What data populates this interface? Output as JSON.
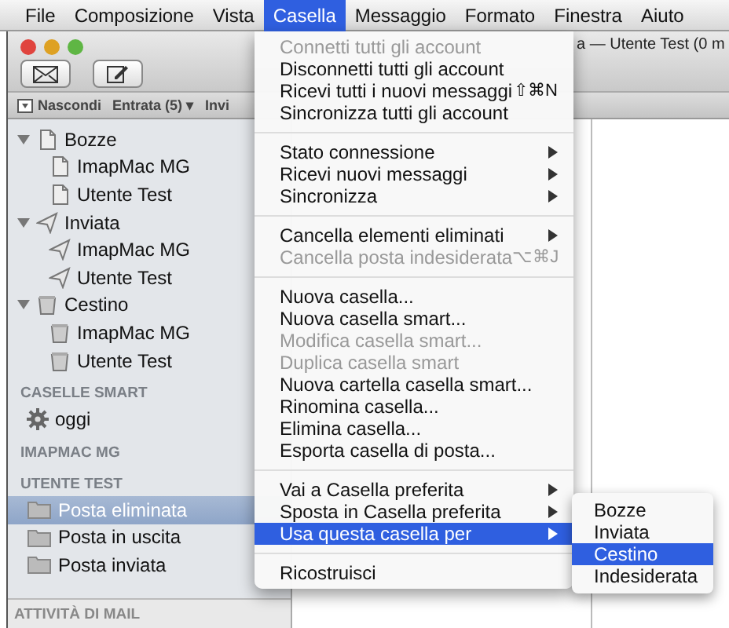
{
  "menubar": {
    "items": [
      {
        "label": "File",
        "selected": false
      },
      {
        "label": "Composizione",
        "selected": false
      },
      {
        "label": "Vista",
        "selected": false
      },
      {
        "label": "Casella",
        "selected": true
      },
      {
        "label": "Messaggio",
        "selected": false
      },
      {
        "label": "Formato",
        "selected": false
      },
      {
        "label": "Finestra",
        "selected": false
      },
      {
        "label": "Aiuto",
        "selected": false
      }
    ]
  },
  "window": {
    "title": "a — Utente Test (0 m",
    "favorites_bar": [
      {
        "label": "Nascondi",
        "kind": "hide"
      },
      {
        "label": "Entrata (5) ▾",
        "kind": "mailbox"
      },
      {
        "label": "Invi",
        "kind": "mailbox"
      }
    ]
  },
  "sidebar": {
    "tree": [
      {
        "label": "Bozze",
        "kind": "draft",
        "expanded": true,
        "children": [
          {
            "label": "ImapMac MG",
            "kind": "draft"
          },
          {
            "label": "Utente Test",
            "kind": "draft"
          }
        ]
      },
      {
        "label": "Inviata",
        "kind": "sent",
        "expanded": true,
        "children": [
          {
            "label": "ImapMac MG",
            "kind": "sent"
          },
          {
            "label": "Utente Test",
            "kind": "sent"
          }
        ]
      },
      {
        "label": "Cestino",
        "kind": "trash",
        "expanded": true,
        "children": [
          {
            "label": "ImapMac MG",
            "kind": "trash"
          },
          {
            "label": "Utente Test",
            "kind": "trash"
          }
        ]
      }
    ],
    "sections": [
      {
        "title": "CASELLE SMART",
        "items": [
          {
            "label": "oggi",
            "kind": "smart",
            "selected": false
          }
        ]
      },
      {
        "title": "IMAPMAC MG"
      },
      {
        "title": "UTENTE TEST",
        "items": [
          {
            "label": "Posta eliminata",
            "kind": "folder",
            "selected": true
          },
          {
            "label": "Posta in uscita",
            "kind": "folder",
            "selected": false
          },
          {
            "label": "Posta inviata",
            "kind": "folder",
            "selected": false
          }
        ]
      }
    ],
    "footer": "ATTIVITÀ DI MAIL"
  },
  "menu": {
    "groups": [
      [
        {
          "label": "Connetti tutti gli account",
          "disabled": true,
          "submenu": false,
          "selected": false
        },
        {
          "label": "Disconnetti tutti gli account",
          "disabled": false,
          "submenu": false,
          "selected": false
        },
        {
          "label": "Ricevi tutti i nuovi messaggi",
          "shortcut": "⇧⌘N",
          "disabled": false,
          "submenu": false,
          "selected": false
        },
        {
          "label": "Sincronizza tutti gli account",
          "disabled": false,
          "submenu": false,
          "selected": false
        }
      ],
      [
        {
          "label": "Stato connessione",
          "disabled": false,
          "submenu": true,
          "selected": false
        },
        {
          "label": "Ricevi nuovi messaggi",
          "disabled": false,
          "submenu": true,
          "selected": false
        },
        {
          "label": "Sincronizza",
          "disabled": false,
          "submenu": true,
          "selected": false
        }
      ],
      [
        {
          "label": "Cancella elementi eliminati",
          "disabled": false,
          "submenu": true,
          "selected": false
        },
        {
          "label": "Cancella posta indesiderata",
          "shortcut": "⌥⌘J",
          "disabled": true,
          "submenu": false,
          "selected": false
        }
      ],
      [
        {
          "label": "Nuova casella...",
          "disabled": false,
          "submenu": false,
          "selected": false
        },
        {
          "label": "Nuova casella smart...",
          "disabled": false,
          "submenu": false,
          "selected": false
        },
        {
          "label": "Modifica casella smart...",
          "disabled": true,
          "submenu": false,
          "selected": false
        },
        {
          "label": "Duplica casella smart",
          "disabled": true,
          "submenu": false,
          "selected": false
        },
        {
          "label": "Nuova cartella casella smart...",
          "disabled": false,
          "submenu": false,
          "selected": false
        },
        {
          "label": "Rinomina casella...",
          "disabled": false,
          "submenu": false,
          "selected": false
        },
        {
          "label": "Elimina casella...",
          "disabled": false,
          "submenu": false,
          "selected": false
        },
        {
          "label": "Esporta casella di posta...",
          "disabled": false,
          "submenu": false,
          "selected": false
        }
      ],
      [
        {
          "label": "Vai a Casella preferita",
          "disabled": false,
          "submenu": true,
          "selected": false
        },
        {
          "label": "Sposta in Casella preferita",
          "disabled": false,
          "submenu": true,
          "selected": false
        },
        {
          "label": "Usa questa casella per",
          "disabled": false,
          "submenu": true,
          "selected": true
        }
      ],
      [
        {
          "label": "Ricostruisci",
          "disabled": false,
          "submenu": false,
          "selected": false
        }
      ]
    ],
    "submenu": [
      {
        "label": "Bozze",
        "selected": false
      },
      {
        "label": "Inviata",
        "selected": false
      },
      {
        "label": "Cestino",
        "selected": true
      },
      {
        "label": "Indesiderata",
        "selected": false
      }
    ]
  }
}
